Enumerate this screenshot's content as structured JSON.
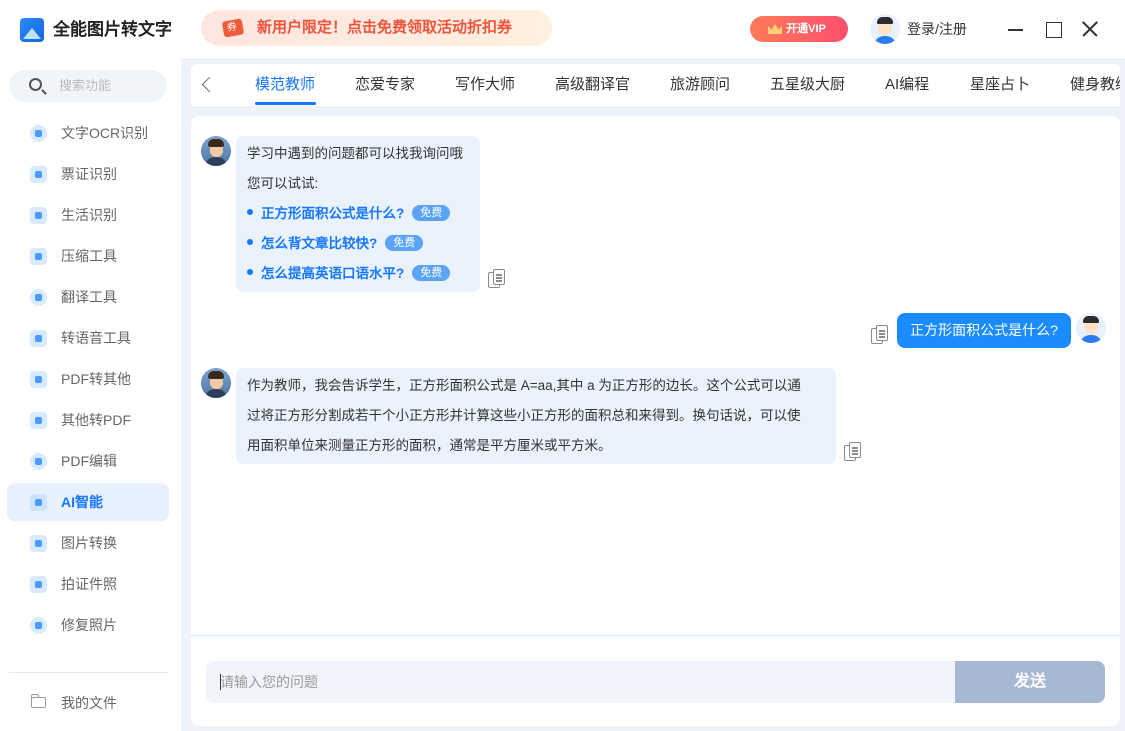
{
  "app": {
    "title": "全能图片转文字",
    "promo_text": "新用户限定！点击免费领取活动折扣券",
    "vip_label": "开通VIP",
    "login_label": "登录/注册"
  },
  "sidebar": {
    "search_placeholder": "搜索功能",
    "items": [
      {
        "label": "文字OCR识别",
        "icon": "ocr-icon"
      },
      {
        "label": "票证识别",
        "icon": "ticket-icon"
      },
      {
        "label": "生活识别",
        "icon": "life-icon"
      },
      {
        "label": "压缩工具",
        "icon": "compress-icon"
      },
      {
        "label": "翻译工具",
        "icon": "translate-icon"
      },
      {
        "label": "转语音工具",
        "icon": "voice-icon"
      },
      {
        "label": "PDF转其他",
        "icon": "pdf-convert-icon"
      },
      {
        "label": "其他转PDF",
        "icon": "to-pdf-icon"
      },
      {
        "label": "PDF编辑",
        "icon": "pdf-edit-icon"
      },
      {
        "label": "AI智能",
        "icon": "ai-icon",
        "active": true
      },
      {
        "label": "图片转换",
        "icon": "image-convert-icon"
      },
      {
        "label": "拍证件照",
        "icon": "id-photo-icon"
      },
      {
        "label": "修复照片",
        "icon": "repair-photo-icon"
      }
    ],
    "files_label": "我的文件"
  },
  "tabs": [
    {
      "label": "模范教师",
      "active": true
    },
    {
      "label": "恋爱专家"
    },
    {
      "label": "写作大师"
    },
    {
      "label": "高级翻译官"
    },
    {
      "label": "旅游顾问"
    },
    {
      "label": "五星级大厨"
    },
    {
      "label": "AI编程"
    },
    {
      "label": "星座占卜"
    },
    {
      "label": "健身教练"
    }
  ],
  "chat": {
    "greeting": {
      "line1": "学习中遇到的问题都可以找我询问哦",
      "line2": "您可以试试:",
      "suggestions": [
        {
          "text": "正方形面积公式是什么?",
          "badge": "免费"
        },
        {
          "text": "怎么背文章比较快?",
          "badge": "免费"
        },
        {
          "text": "怎么提高英语口语水平?",
          "badge": "免费"
        }
      ]
    },
    "user_message": "正方形面积公式是什么?",
    "answer": {
      "lines": [
        "作为教师，我会告诉学生，正方形面积公式是 A=aa,其中 a 为正方形的边长。这个公式可以通",
        "过将正方形分割成若干个小正方形并计算这些小正方形的面积总和来得到。换句话说，可以使",
        "用面积单位来测量正方形的面积，通常是平方厘米或平方米。"
      ]
    }
  },
  "composer": {
    "placeholder": "请输入您的问题",
    "send_label": "发送"
  },
  "colors": {
    "accent": "#1677ff",
    "promo_text": "#f0523c",
    "send_disabled": "#a6b8d3"
  }
}
